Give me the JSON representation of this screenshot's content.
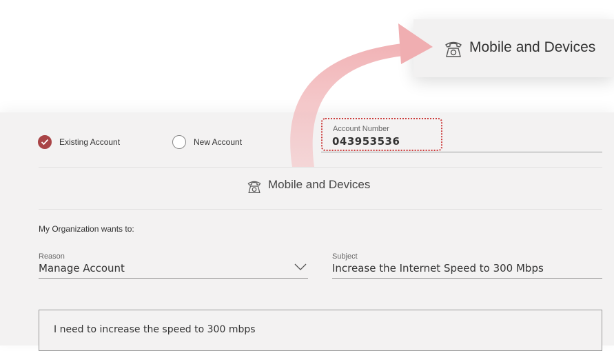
{
  "callout": {
    "icon": "telephone-icon",
    "label": "Mobile and Devices"
  },
  "account_type": {
    "options": [
      {
        "label": "Existing Account",
        "checked": true
      },
      {
        "label": "New Account",
        "checked": false
      }
    ]
  },
  "account_number": {
    "label": "Account Number",
    "value": "043953536"
  },
  "section": {
    "icon": "telephone-icon",
    "title": "Mobile and Devices"
  },
  "form": {
    "intro": "My Organization wants to:",
    "reason": {
      "label": "Reason",
      "value": "Manage Account"
    },
    "subject": {
      "label": "Subject",
      "value": "Increase the Internet Speed to 300 Mbps"
    },
    "message": "I need to increase the speed to 300 mbps"
  },
  "colors": {
    "accent": "#a94446",
    "highlight_border": "#cc3c3c",
    "arrow": "#f2b4b6",
    "panel_bg": "#f3f2f2"
  }
}
